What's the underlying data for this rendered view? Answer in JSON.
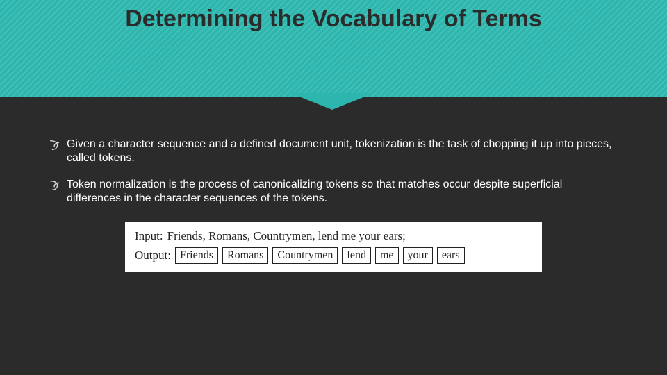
{
  "header": {
    "title": "Determining the Vocabulary of Terms"
  },
  "bullets": [
    "Given a character sequence and a defined document unit, tokenization is the task of chopping it up into pieces, called tokens.",
    "Token normalization is the process of canonicalizing tokens so that matches occur despite superficial differences in the character sequences of the tokens."
  ],
  "example": {
    "input_label": "Input:",
    "input_text": "Friends, Romans, Countrymen, lend me your ears;",
    "output_label": "Output:",
    "tokens": [
      "Friends",
      "Romans",
      "Countrymen",
      "lend",
      "me",
      "your",
      "ears"
    ]
  }
}
